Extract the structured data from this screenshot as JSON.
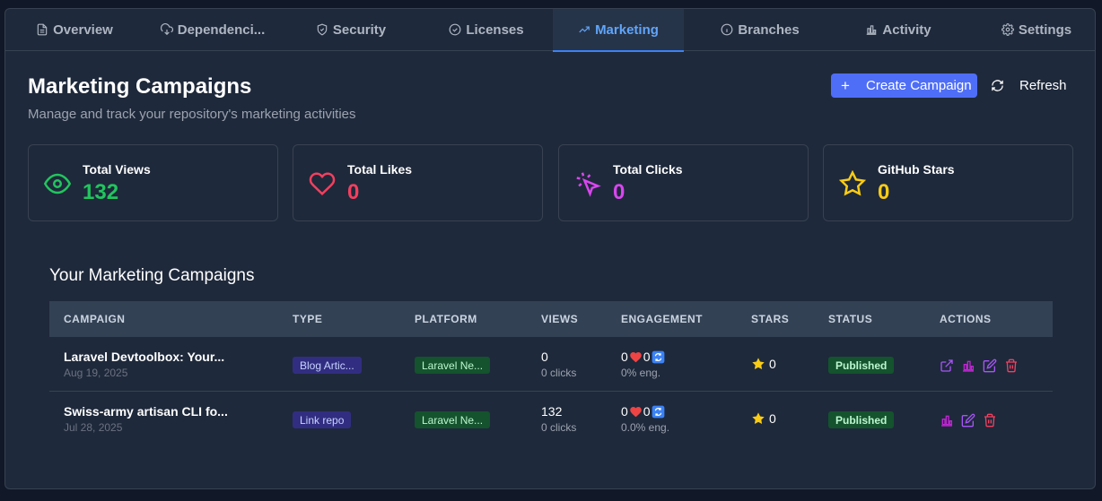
{
  "tabs": [
    {
      "label": "Overview",
      "icon": "document-icon"
    },
    {
      "label": "Dependenci...",
      "icon": "cloud-download-icon"
    },
    {
      "label": "Security",
      "icon": "shield-icon"
    },
    {
      "label": "Licenses",
      "icon": "check-circle-icon"
    },
    {
      "label": "Marketing",
      "icon": "trending-up-icon",
      "active": true
    },
    {
      "label": "Branches",
      "icon": "info-circle-icon"
    },
    {
      "label": "Activity",
      "icon": "bar-chart-icon"
    },
    {
      "label": "Settings",
      "icon": "gear-icon"
    }
  ],
  "header": {
    "title": "Marketing Campaigns",
    "subtitle": "Manage and track your repository's marketing activities",
    "create_label": "Create Campaign",
    "refresh_label": "Refresh"
  },
  "stats": [
    {
      "label": "Total Views",
      "value": "132",
      "color": "#22c55e",
      "icon": "eye-icon"
    },
    {
      "label": "Total Likes",
      "value": "0",
      "color": "#f43f5e",
      "icon": "heart-icon"
    },
    {
      "label": "Total Clicks",
      "value": "0",
      "color": "#d946ef",
      "icon": "cursor-click-icon"
    },
    {
      "label": "GitHub Stars",
      "value": "0",
      "color": "#facc15",
      "icon": "star-icon"
    }
  ],
  "section_title": "Your Marketing Campaigns",
  "table": {
    "headers": [
      "CAMPAIGN",
      "TYPE",
      "PLATFORM",
      "VIEWS",
      "ENGAGEMENT",
      "STARS",
      "STATUS",
      "ACTIONS"
    ],
    "rows": [
      {
        "name": "Laravel Devtoolbox: Your...",
        "date": "Aug 19, 2025",
        "type": "Blog Artic...",
        "platform": "Laravel Ne...",
        "views": "0",
        "clicks": "0 clicks",
        "likes": "0",
        "reposts": "0",
        "eng": "0% eng.",
        "stars": "0",
        "status": "Published",
        "actions": [
          "external-link-icon",
          "bar-chart-icon",
          "edit-icon",
          "trash-icon"
        ]
      },
      {
        "name": "Swiss-army artisan CLI fo...",
        "date": "Jul 28, 2025",
        "type": "Link repo",
        "platform": "Laravel Ne...",
        "views": "132",
        "clicks": "0 clicks",
        "likes": "0",
        "reposts": "0",
        "eng": "0.0% eng.",
        "stars": "0",
        "status": "Published",
        "actions": [
          "bar-chart-icon",
          "edit-icon",
          "trash-icon"
        ]
      }
    ]
  },
  "colors": {
    "accent": "#4f6ef7",
    "active_tab": "#60a5fa"
  }
}
